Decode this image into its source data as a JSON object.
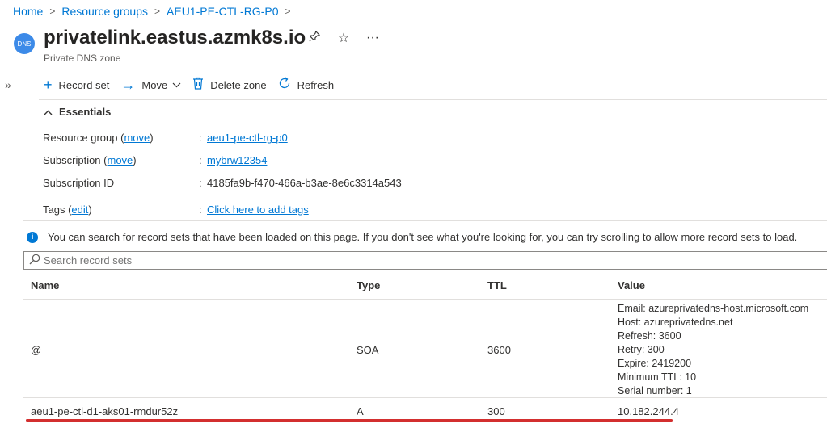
{
  "breadcrumb": [
    "Home",
    "Resource groups",
    "AEU1-PE-CTL-RG-P0"
  ],
  "breadcrumb_sep": ">",
  "header": {
    "icon_text": "DNS",
    "title": "privatelink.eastus.azmk8s.io",
    "subtitle": "Private DNS zone",
    "icons": [
      "pin-icon",
      "star-icon",
      "more-icon"
    ]
  },
  "collapse_glyph": "»",
  "toolbar": {
    "record_set": "Record set",
    "move": "Move",
    "delete_zone": "Delete zone",
    "refresh": "Refresh"
  },
  "essentials": {
    "heading": "Essentials",
    "resource_group_label": "Resource group",
    "resource_group_link": "move",
    "resource_group_value": "aeu1-pe-ctl-rg-p0",
    "subscription_label": "Subscription",
    "subscription_link": "move",
    "subscription_value": "mybrw12354",
    "subscription_id_label": "Subscription ID",
    "subscription_id_value": "4185fa9b-f470-466a-b3ae-8e6c3314a543",
    "tags_label": "Tags",
    "tags_link": "edit",
    "tags_value": "Click here to add tags"
  },
  "info_message": "You can search for record sets that have been loaded on this page. If you don't see what you're looking for, you can try scrolling to allow more record sets to load.",
  "search": {
    "placeholder": "Search record sets"
  },
  "table": {
    "columns": [
      "Name",
      "Type",
      "TTL",
      "Value"
    ],
    "rows": [
      {
        "name": "@",
        "type": "SOA",
        "ttl": "3600",
        "value": [
          "Email: azureprivatedns-host.microsoft.com",
          "Host: azureprivatedns.net",
          "Refresh: 3600",
          "Retry: 300",
          "Expire: 2419200",
          "Minimum TTL: 10",
          "Serial number: 1"
        ]
      },
      {
        "name": "aeu1-pe-ctl-d1-aks01-rmdur52z",
        "type": "A",
        "ttl": "300",
        "value": [
          "10.182.244.4"
        ]
      }
    ]
  },
  "colors": {
    "accent": "#0078d4",
    "highlight_underline": "#d32f2f"
  }
}
